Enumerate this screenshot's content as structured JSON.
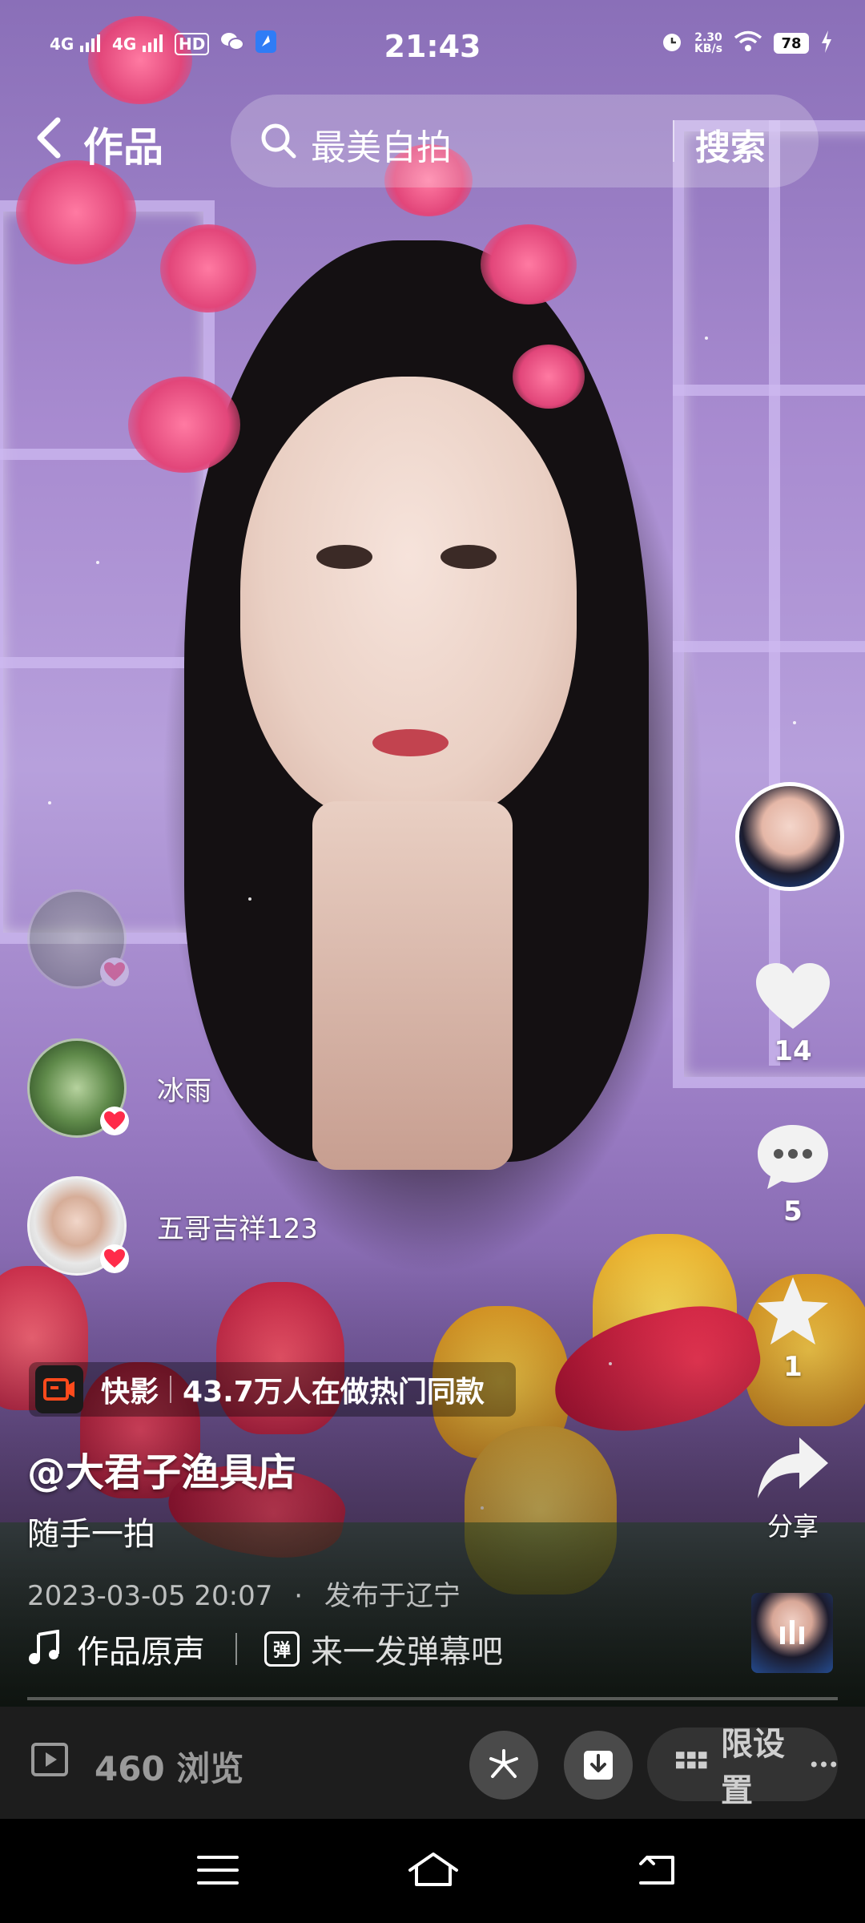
{
  "status_bar": {
    "signal_1": "4G",
    "signal_2": "4G",
    "hd_badge": "HD",
    "time": "21:43",
    "speed_value": "2.30",
    "speed_unit": "KB/s",
    "battery": "78",
    "icons": [
      "signal-icon",
      "signal-icon",
      "hd-icon",
      "wechat-icon",
      "app-notification-icon",
      "alarm-icon",
      "wifi-icon",
      "battery-icon",
      "charging-icon"
    ]
  },
  "header": {
    "title": "作品",
    "search_query": "最美自拍",
    "search_button": "搜索"
  },
  "actions": {
    "like_count": "14",
    "comment_count": "5",
    "favorite_count": "1",
    "share_label": "分享"
  },
  "likers": [
    {
      "name": "冰雨"
    },
    {
      "name": "五哥吉祥123"
    }
  ],
  "kuaiying": {
    "brand": "快影",
    "promo": "43.7万人在做热门同款"
  },
  "post": {
    "author": "@大君子渔具店",
    "caption": "随手一拍",
    "timestamp": "2023-03-05 20:07",
    "location": "发布于辽宁",
    "music": "作品原声",
    "danmu_icon_text": "弹",
    "danmu_prompt": "来一发弹幕吧"
  },
  "bottom_bar": {
    "views": "460 浏览",
    "settings_label": "限设置"
  },
  "colors": {
    "accent_heart": "#ff2b4a",
    "bottom_bar_bg": "#1d1d1d"
  }
}
